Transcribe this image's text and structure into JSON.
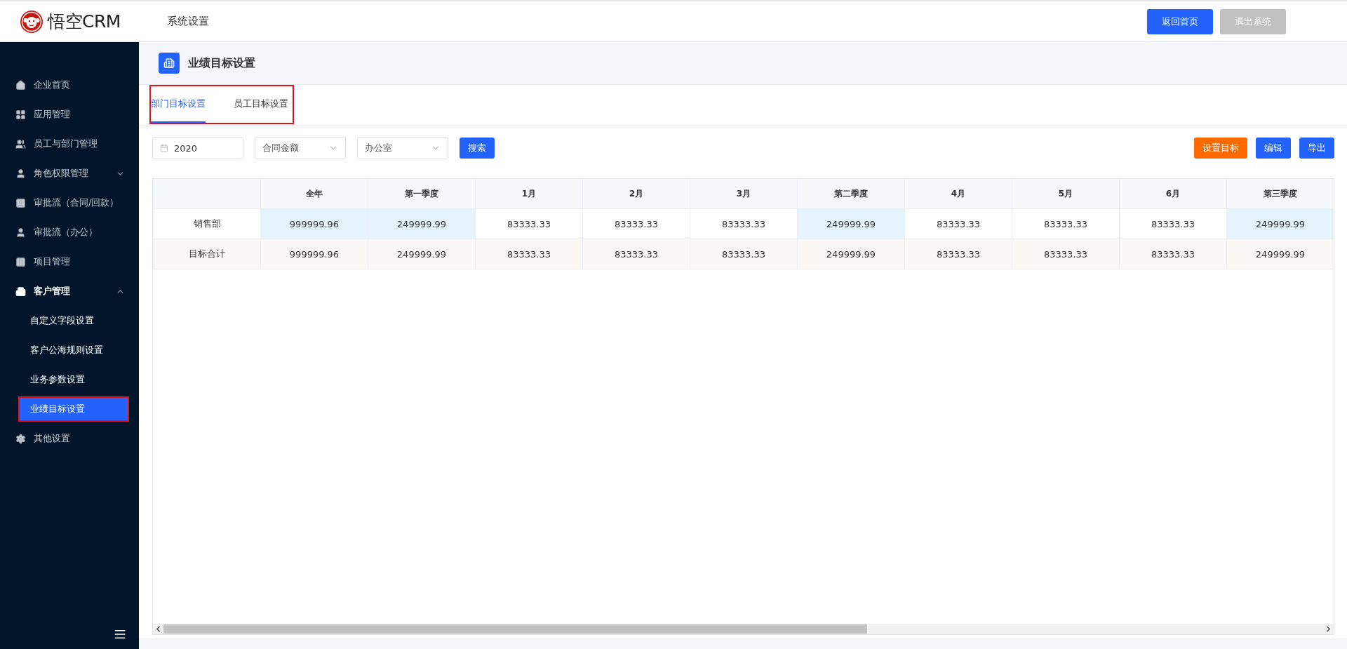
{
  "header": {
    "logo_text": "悟空CRM",
    "title": "系统设置",
    "buttons": [
      {
        "label": "返回首页",
        "disabled": false
      },
      {
        "label": "退出系统",
        "disabled": true
      }
    ]
  },
  "sidebar": {
    "items": [
      {
        "label": "企业首页"
      },
      {
        "label": "应用管理"
      },
      {
        "label": "员工与部门管理"
      },
      {
        "label": "角色权限管理",
        "expanded": false
      },
      {
        "label": "审批流（合同/回款）"
      },
      {
        "label": "审批流（办公）"
      },
      {
        "label": "项目管理"
      },
      {
        "label": "客户管理",
        "expanded": true,
        "children": [
          {
            "label": "自定义字段设置",
            "selected": false
          },
          {
            "label": "客户公海规则设置",
            "selected": false
          },
          {
            "label": "业务参数设置",
            "selected": false
          },
          {
            "label": "业绩目标设置",
            "selected": true
          }
        ]
      },
      {
        "label": "其他设置"
      }
    ]
  },
  "page": {
    "title": "业绩目标设置"
  },
  "tabs": [
    {
      "label": "部门目标设置",
      "selected": true
    },
    {
      "label": "员工目标设置",
      "selected": false
    }
  ],
  "filters": {
    "year": "2020",
    "selects": [
      "合同金额",
      "办公室"
    ],
    "search_button": "搜索"
  },
  "actions": [
    {
      "label": "设置目标",
      "kind": "warning"
    },
    {
      "label": "编辑",
      "kind": "primary"
    },
    {
      "label": "导出",
      "kind": "primary"
    }
  ],
  "table": {
    "columns": [
      {
        "label": "全年",
        "kind": "year"
      },
      {
        "label": "第一季度",
        "kind": "quarter"
      },
      {
        "label": "1月",
        "kind": "month"
      },
      {
        "label": "2月",
        "kind": "month"
      },
      {
        "label": "3月",
        "kind": "month"
      },
      {
        "label": "第二季度",
        "kind": "quarter"
      },
      {
        "label": "4月",
        "kind": "month"
      },
      {
        "label": "5月",
        "kind": "month"
      },
      {
        "label": "6月",
        "kind": "month"
      },
      {
        "label": "第三季度",
        "kind": "quarter"
      }
    ],
    "rows": [
      {
        "label": "销售部",
        "kind": "department",
        "cells": [
          "999999.96",
          "249999.99",
          "83333.33",
          "83333.33",
          "83333.33",
          "249999.99",
          "83333.33",
          "83333.33",
          "83333.33",
          "249999.99"
        ]
      },
      {
        "label": "目标合计",
        "kind": "total",
        "cells": [
          "999999.96",
          "249999.99",
          "83333.33",
          "83333.33",
          "83333.33",
          "249999.99",
          "83333.33",
          "83333.33",
          "83333.33",
          "249999.99"
        ]
      }
    ]
  }
}
